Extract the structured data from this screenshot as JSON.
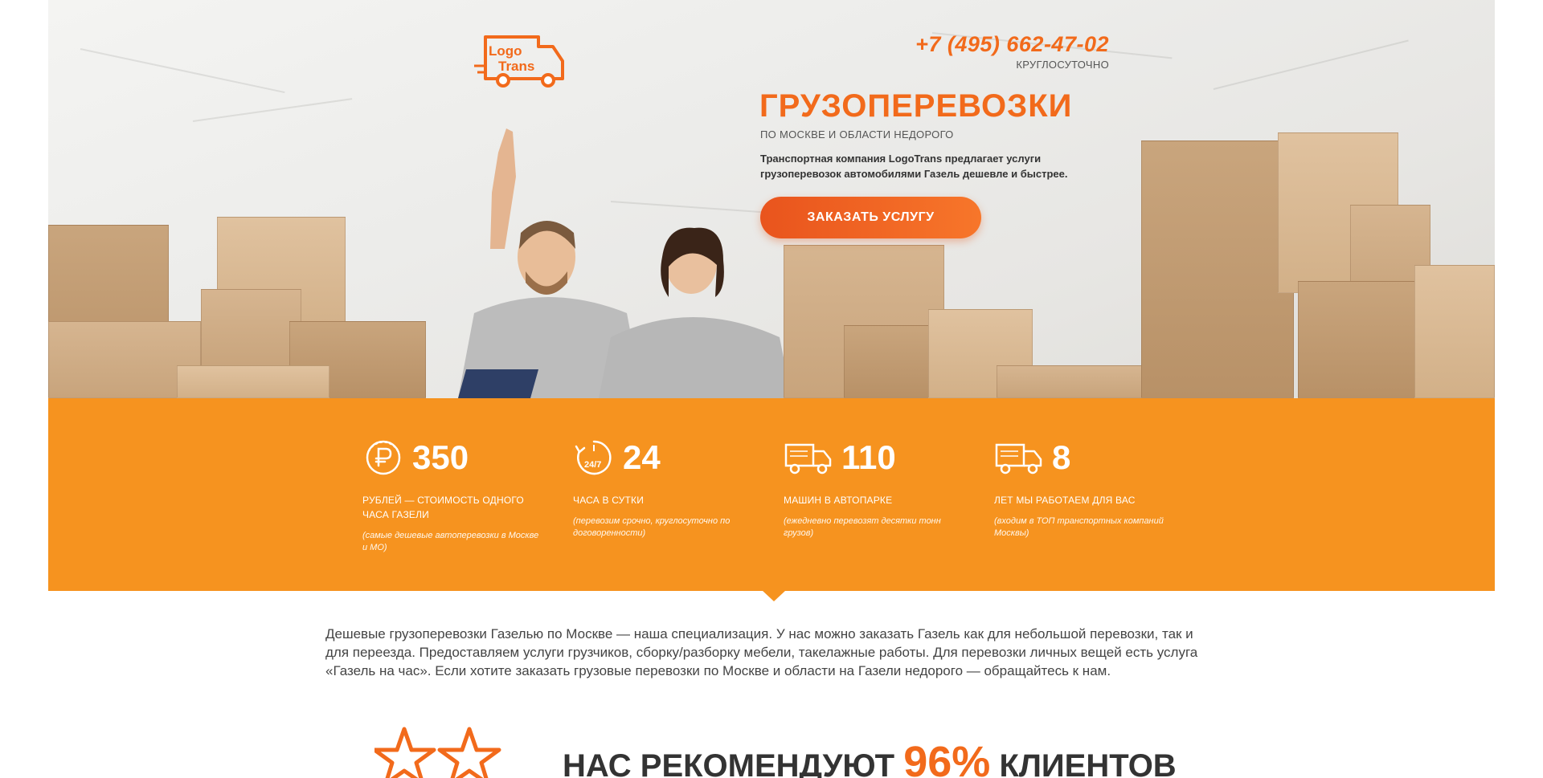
{
  "logo": {
    "line1": "Logo",
    "line2": "Trans"
  },
  "header": {
    "phone": "+7 (495) 662-47-02",
    "phone_sub": "КРУГЛОСУТОЧНО"
  },
  "hero": {
    "title": "ГРУЗОПЕРЕВОЗКИ",
    "subtitle": "ПО МОСКВЕ И ОБЛАСТИ НЕДОРОГО",
    "description": "Транспортная компания LogoTrans предлагает услуги грузоперевозок автомобилями Газель дешевле и быстрее.",
    "cta_label": "ЗАКАЗАТЬ УСЛУГУ"
  },
  "stats": [
    {
      "icon": "ruble-coin-icon",
      "value": "350",
      "label": "РУБЛЕЙ — СТОИМОСТЬ ОДНОГО ЧАСА ГАЗЕЛИ",
      "note": "(самые дешевые автоперевозки в Москве и МО)"
    },
    {
      "icon": "clock-24-7-icon",
      "value": "24",
      "label": "ЧАСА В СУТКИ",
      "note": "(перевозим срочно, круглосуточно по договоренности)"
    },
    {
      "icon": "truck-icon",
      "value": "110",
      "label": "МАШИН В АВТОПАРКЕ",
      "note": "(ежедневно перевозят десятки тонн грузов)"
    },
    {
      "icon": "truck-icon",
      "value": "8",
      "label": "ЛЕТ МЫ РАБОТАЕМ ДЛЯ ВАС",
      "note": "(входим в ТОП транспортных компаний Москвы)"
    }
  ],
  "intro": {
    "text": "Дешевые грузоперевозки Газелью по Москве — наша специализация. У нас можно заказать Газель как для небольшой перевозки, так и для переезда. Предоставляем услуги грузчиков, сборку/разборку мебели, такелажные работы. Для перевозки личных вещей есть услуга «Газель на час». Если хотите заказать грузовые перевозки по Москве и области на Газели недорого — обращайтесь к нам."
  },
  "recommend": {
    "prefix": "НАС РЕКОМЕНДУЮТ",
    "percent": "96%",
    "suffix": "КЛИЕНТОВ"
  },
  "colors": {
    "accent": "#f26a1b",
    "stats_bg": "#f6931f",
    "text": "#333333"
  }
}
